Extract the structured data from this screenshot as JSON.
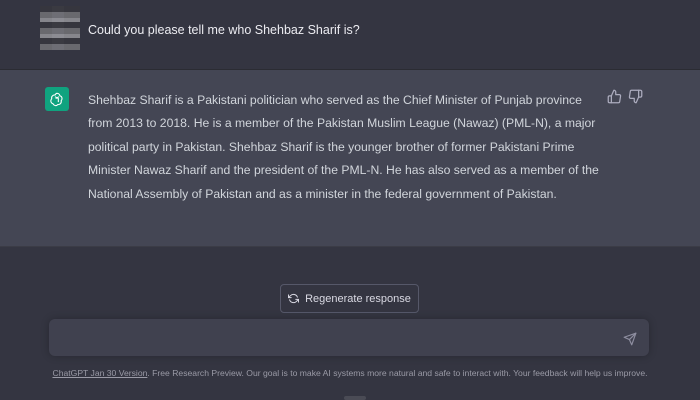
{
  "user_message": {
    "text": "Could you please tell me who Shehbaz Sharif is?"
  },
  "assistant_message": {
    "text": "Shehbaz Sharif is a Pakistani politician who served as the Chief Minister of Punjab province from 2013 to 2018. He is a member of the Pakistan Muslim League (Nawaz) (PML-N), a major political party in Pakistan. Shehbaz Sharif is the younger brother of former Pakistani Prime Minister Nawaz Sharif and the president of the PML-N. He has also served as a member of the National Assembly of Pakistan and as a minister in the federal government of Pakistan."
  },
  "actions": {
    "regenerate_label": "Regenerate response"
  },
  "input": {
    "value": "",
    "placeholder": ""
  },
  "footer": {
    "version_link": "ChatGPT Jan 30 Version",
    "text": ". Free Research Preview. Our goal is to make AI systems more natural and safe to interact with. Your feedback will help us improve."
  },
  "icons": {
    "assistant_avatar": "openai-logo-icon",
    "thumbs_up": "thumbs-up-icon",
    "thumbs_down": "thumbs-down-icon",
    "regenerate": "refresh-icon",
    "send": "paper-plane-icon"
  },
  "colors": {
    "background": "#343541",
    "assistant_row": "#444654",
    "brand_green": "#10a37f",
    "input_bg": "#40414f"
  }
}
